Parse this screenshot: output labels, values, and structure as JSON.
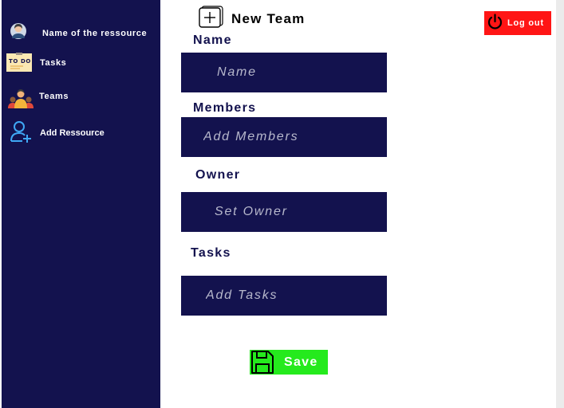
{
  "sidebar": {
    "profile": {
      "label": "Name of the ressource",
      "icon": "user-avatar-icon"
    },
    "items": [
      {
        "label": "Tasks",
        "icon": "todo-note-icon"
      },
      {
        "label": "Teams",
        "icon": "team-group-icon"
      },
      {
        "label": "Add Ressource",
        "icon": "add-user-icon"
      }
    ]
  },
  "header": {
    "title": "New Team",
    "icon": "plus-square-icon"
  },
  "logout": {
    "label": "Log out",
    "icon": "power-icon",
    "color": "#ff1515"
  },
  "form": {
    "name": {
      "label": "Name",
      "placeholder": "Name"
    },
    "members": {
      "label": "Members",
      "placeholder": "Add Members"
    },
    "owner": {
      "label": "Owner",
      "placeholder": "Set Owner"
    },
    "tasks": {
      "label": "Tasks",
      "placeholder": "Add Tasks"
    }
  },
  "save": {
    "label": "Save",
    "icon": "floppy-disk-icon",
    "color": "#25ea1d"
  },
  "colors": {
    "sidebar": "#13124e",
    "accent": "#13124e"
  }
}
